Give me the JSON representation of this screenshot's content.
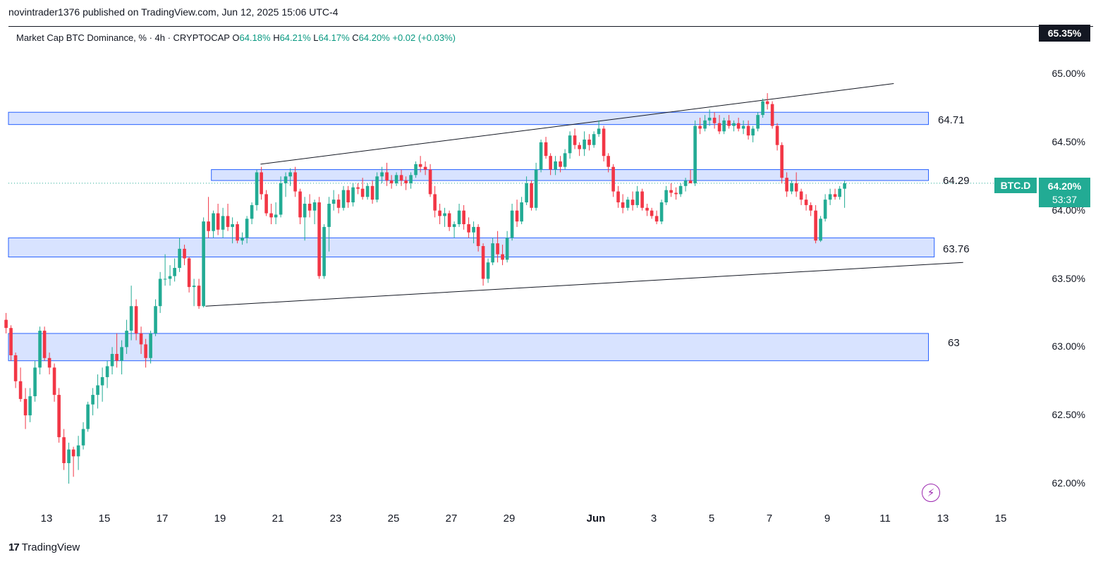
{
  "header": {
    "published": "novintrader1376 published on TradingView.com, Jun 12, 2025 15:06 UTC-4"
  },
  "legend": {
    "title": "Market Cap BTC Dominance, % · 4h · CRYPTOCAP",
    "o_key": "O",
    "o_val": "64.18%",
    "h_key": "H",
    "h_val": "64.21%",
    "l_key": "L",
    "l_val": "64.17%",
    "c_key": "C",
    "c_val": "64.20%",
    "change": "+0.02 (+0.03%)"
  },
  "price_axis": {
    "top_badge": "65.35%",
    "symbol_badge": "BTC.D",
    "last_price": "64.20%",
    "countdown": "53:37"
  },
  "zones": {
    "z1": "64.71",
    "z2": "64.29",
    "z3": "63.76",
    "z4": "63"
  },
  "footer": {
    "brand": "TradingView"
  },
  "colors": {
    "up": "#22ab94",
    "down": "#f23645",
    "zone_fill": "#d1deff",
    "zone_border": "#2962ff",
    "line": "#131722"
  },
  "chart_data": {
    "type": "candlestick",
    "title": "Market Cap BTC Dominance, % · 4h · CRYPTOCAP",
    "ylim": [
      61.85,
      65.45
    ],
    "y_ticks": [
      "62.00%",
      "62.50%",
      "63.00%",
      "63.50%",
      "64.00%",
      "64.50%",
      "65.00%"
    ],
    "y_tick_values": [
      62.0,
      62.5,
      63.0,
      63.5,
      64.0,
      64.5,
      65.0
    ],
    "x_ticks": [
      "13",
      "15",
      "17",
      "19",
      "21",
      "23",
      "25",
      "27",
      "29",
      "Jun",
      "3",
      "5",
      "7",
      "9",
      "11",
      "13",
      "15"
    ],
    "x_tick_days": [
      13,
      15,
      17,
      19,
      21,
      23,
      25,
      27,
      29,
      32,
      34,
      36,
      38,
      40,
      42,
      44,
      46
    ],
    "x_range_days": [
      11.6,
      48.3
    ],
    "zones": [
      {
        "label": "64.71",
        "low": 64.63,
        "high": 64.72,
        "start_day": 11.6,
        "end_day": 43.5
      },
      {
        "label": "64.29",
        "low": 64.22,
        "high": 64.3,
        "start_day": 18.7,
        "end_day": 43.5
      },
      {
        "label": "63.76",
        "low": 63.66,
        "high": 63.8,
        "start_day": 11.6,
        "end_day": 43.7
      },
      {
        "label": "63",
        "low": 62.9,
        "high": 63.1,
        "start_day": 11.6,
        "end_day": 43.5
      }
    ],
    "trendlines": [
      {
        "from": [
          20.4,
          64.34
        ],
        "to": [
          42.3,
          64.93
        ]
      },
      {
        "from": [
          18.5,
          63.3
        ],
        "to": [
          44.7,
          63.62
        ]
      }
    ],
    "last_price": 64.2,
    "candles": [
      [
        11.6,
        63.2,
        63.25,
        63.1,
        63.14
      ],
      [
        11.77,
        63.14,
        63.16,
        62.9,
        62.94
      ],
      [
        11.93,
        62.94,
        62.96,
        62.7,
        62.75
      ],
      [
        12.1,
        62.75,
        62.85,
        62.6,
        62.62
      ],
      [
        12.27,
        62.62,
        62.7,
        62.4,
        62.5
      ],
      [
        12.43,
        62.5,
        62.7,
        62.45,
        62.64
      ],
      [
        12.6,
        62.64,
        62.9,
        62.6,
        62.85
      ],
      [
        12.77,
        62.85,
        63.15,
        62.8,
        63.12
      ],
      [
        12.93,
        63.12,
        63.15,
        62.9,
        62.92
      ],
      [
        13.1,
        62.92,
        62.96,
        62.8,
        62.85
      ],
      [
        13.27,
        62.85,
        62.88,
        62.6,
        62.65
      ],
      [
        13.43,
        62.65,
        62.7,
        62.3,
        62.34
      ],
      [
        13.6,
        62.34,
        62.4,
        62.1,
        62.15
      ],
      [
        13.77,
        62.15,
        62.3,
        62.0,
        62.25
      ],
      [
        13.93,
        62.25,
        62.27,
        62.05,
        62.2
      ],
      [
        14.1,
        62.2,
        62.35,
        62.1,
        62.28
      ],
      [
        14.27,
        62.28,
        62.45,
        62.25,
        62.4
      ],
      [
        14.43,
        62.4,
        62.6,
        62.38,
        62.58
      ],
      [
        14.6,
        62.58,
        62.7,
        62.5,
        62.65
      ],
      [
        14.77,
        62.65,
        62.8,
        62.55,
        62.72
      ],
      [
        14.93,
        62.72,
        62.85,
        62.6,
        62.78
      ],
      [
        15.1,
        62.78,
        62.9,
        62.7,
        62.86
      ],
      [
        15.27,
        62.86,
        63.0,
        62.8,
        62.95
      ],
      [
        15.43,
        62.95,
        63.1,
        62.85,
        62.9
      ],
      [
        15.6,
        62.9,
        63.05,
        62.8,
        63.0
      ],
      [
        15.77,
        63.0,
        63.2,
        62.95,
        63.12
      ],
      [
        15.93,
        63.12,
        63.45,
        63.05,
        63.3
      ],
      [
        16.1,
        63.3,
        63.35,
        63.05,
        63.1
      ],
      [
        16.27,
        63.1,
        63.15,
        62.95,
        63.02
      ],
      [
        16.43,
        63.02,
        63.06,
        62.85,
        62.92
      ],
      [
        16.6,
        62.92,
        63.12,
        62.88,
        63.1
      ],
      [
        16.77,
        63.1,
        63.35,
        63.08,
        63.3
      ],
      [
        16.93,
        63.3,
        63.55,
        63.25,
        63.5
      ],
      [
        17.1,
        63.5,
        63.68,
        63.45,
        63.5
      ],
      [
        17.27,
        63.5,
        63.6,
        63.45,
        63.52
      ],
      [
        17.43,
        63.52,
        63.65,
        63.48,
        63.58
      ],
      [
        17.6,
        63.58,
        63.8,
        63.55,
        63.72
      ],
      [
        17.77,
        63.72,
        63.75,
        63.6,
        63.65
      ],
      [
        17.93,
        63.65,
        63.66,
        63.4,
        63.44
      ],
      [
        18.1,
        63.44,
        63.5,
        63.3,
        63.45
      ],
      [
        18.27,
        63.45,
        63.5,
        63.28,
        63.3
      ],
      [
        18.43,
        63.3,
        63.95,
        63.29,
        63.92
      ],
      [
        18.6,
        63.92,
        64.1,
        63.8,
        63.85
      ],
      [
        18.77,
        63.85,
        64.0,
        63.8,
        63.98
      ],
      [
        18.93,
        63.98,
        64.05,
        63.82,
        63.86
      ],
      [
        19.1,
        63.86,
        64.02,
        63.8,
        63.96
      ],
      [
        19.27,
        63.96,
        64.05,
        63.85,
        63.88
      ],
      [
        19.43,
        63.88,
        63.95,
        63.76,
        63.9
      ],
      [
        19.6,
        63.9,
        63.92,
        63.76,
        63.78
      ],
      [
        19.77,
        63.78,
        63.84,
        63.75,
        63.8
      ],
      [
        19.93,
        63.8,
        63.96,
        63.76,
        63.94
      ],
      [
        20.1,
        63.94,
        64.06,
        63.9,
        64.04
      ],
      [
        20.27,
        64.04,
        64.3,
        64.0,
        64.28
      ],
      [
        20.43,
        64.28,
        64.32,
        64.08,
        64.12
      ],
      [
        20.6,
        64.12,
        64.15,
        63.96,
        63.98
      ],
      [
        20.77,
        63.98,
        64.05,
        63.9,
        63.95
      ],
      [
        20.93,
        63.95,
        64.06,
        63.9,
        63.97
      ],
      [
        21.1,
        63.97,
        64.25,
        63.95,
        64.2
      ],
      [
        21.27,
        64.2,
        64.28,
        64.1,
        64.25
      ],
      [
        21.43,
        64.25,
        64.31,
        64.18,
        64.28
      ],
      [
        21.6,
        64.28,
        64.32,
        64.1,
        64.14
      ],
      [
        21.77,
        64.14,
        64.16,
        63.9,
        63.95
      ],
      [
        21.93,
        63.95,
        64.1,
        63.78,
        64.05
      ],
      [
        22.1,
        64.05,
        64.12,
        63.95,
        64.0
      ],
      [
        22.27,
        64.0,
        64.08,
        63.9,
        64.06
      ],
      [
        22.43,
        64.06,
        64.1,
        63.5,
        63.52
      ],
      [
        22.6,
        63.52,
        63.9,
        63.5,
        63.88
      ],
      [
        22.77,
        63.88,
        64.1,
        63.7,
        64.05
      ],
      [
        22.93,
        64.05,
        64.15,
        64.0,
        64.08
      ],
      [
        23.1,
        64.08,
        64.12,
        63.98,
        64.02
      ],
      [
        23.27,
        64.02,
        64.18,
        64.0,
        64.15
      ],
      [
        23.43,
        64.15,
        64.18,
        64.02,
        64.06
      ],
      [
        23.6,
        64.06,
        64.2,
        64.03,
        64.17
      ],
      [
        23.77,
        64.17,
        64.2,
        64.12,
        64.16
      ],
      [
        23.93,
        64.16,
        64.24,
        64.08,
        64.1
      ],
      [
        24.1,
        64.1,
        64.2,
        64.08,
        64.18
      ],
      [
        24.27,
        64.18,
        64.22,
        64.05,
        64.08
      ],
      [
        24.43,
        64.08,
        64.28,
        64.06,
        64.25
      ],
      [
        24.6,
        64.25,
        64.32,
        64.2,
        64.28
      ],
      [
        24.77,
        64.28,
        64.35,
        64.18,
        64.22
      ],
      [
        24.93,
        64.22,
        64.26,
        64.16,
        64.2
      ],
      [
        25.1,
        64.2,
        64.28,
        64.18,
        64.26
      ],
      [
        25.27,
        64.26,
        64.3,
        64.18,
        64.22
      ],
      [
        25.43,
        64.22,
        64.25,
        64.15,
        64.2
      ],
      [
        25.6,
        64.2,
        64.28,
        64.16,
        64.26
      ],
      [
        25.77,
        64.26,
        64.36,
        64.24,
        64.34
      ],
      [
        25.93,
        64.34,
        64.4,
        64.28,
        64.32
      ],
      [
        26.1,
        64.32,
        64.36,
        64.26,
        64.3
      ],
      [
        26.27,
        64.3,
        64.34,
        64.1,
        64.12
      ],
      [
        26.43,
        64.12,
        64.18,
        63.95,
        64.0
      ],
      [
        26.6,
        64.0,
        64.05,
        63.9,
        63.96
      ],
      [
        26.77,
        63.96,
        64.02,
        63.88,
        63.98
      ],
      [
        26.93,
        63.98,
        64.0,
        63.85,
        63.88
      ],
      [
        27.1,
        63.88,
        63.92,
        63.8,
        63.9
      ],
      [
        27.27,
        63.9,
        64.05,
        63.88,
        64.0
      ],
      [
        27.43,
        64.0,
        64.04,
        63.86,
        63.9
      ],
      [
        27.6,
        63.9,
        63.95,
        63.8,
        63.84
      ],
      [
        27.77,
        63.84,
        63.92,
        63.76,
        63.88
      ],
      [
        27.93,
        63.88,
        63.9,
        63.7,
        63.74
      ],
      [
        28.1,
        63.74,
        63.76,
        63.45,
        63.5
      ],
      [
        28.27,
        63.5,
        63.65,
        63.47,
        63.62
      ],
      [
        28.43,
        63.62,
        63.8,
        63.6,
        63.76
      ],
      [
        28.6,
        63.76,
        63.85,
        63.62,
        63.68
      ],
      [
        28.77,
        63.68,
        63.75,
        63.6,
        63.64
      ],
      [
        28.93,
        63.64,
        63.85,
        63.62,
        63.8
      ],
      [
        29.1,
        63.8,
        64.05,
        63.78,
        64.0
      ],
      [
        29.27,
        64.0,
        64.08,
        63.88,
        63.92
      ],
      [
        29.43,
        63.92,
        64.1,
        63.9,
        64.06
      ],
      [
        29.6,
        64.06,
        64.25,
        64.04,
        64.2
      ],
      [
        29.77,
        64.2,
        64.22,
        64.0,
        64.02
      ],
      [
        29.93,
        64.02,
        64.35,
        64.0,
        64.3
      ],
      [
        30.1,
        64.3,
        64.52,
        64.28,
        64.5
      ],
      [
        30.27,
        64.5,
        64.54,
        64.38,
        64.4
      ],
      [
        30.43,
        64.4,
        64.42,
        64.26,
        64.3
      ],
      [
        30.6,
        64.3,
        64.4,
        64.26,
        64.36
      ],
      [
        30.77,
        64.36,
        64.4,
        64.28,
        64.32
      ],
      [
        30.93,
        64.32,
        64.45,
        64.3,
        64.42
      ],
      [
        31.1,
        64.42,
        64.58,
        64.38,
        64.55
      ],
      [
        31.27,
        64.55,
        64.6,
        64.45,
        64.48
      ],
      [
        31.43,
        64.48,
        64.5,
        64.4,
        64.45
      ],
      [
        31.6,
        64.45,
        64.58,
        64.4,
        64.52
      ],
      [
        31.77,
        64.52,
        64.56,
        64.44,
        64.48
      ],
      [
        31.93,
        64.48,
        64.58,
        64.46,
        64.56
      ],
      [
        32.1,
        64.56,
        64.66,
        64.54,
        64.6
      ],
      [
        32.27,
        64.6,
        64.62,
        64.36,
        64.4
      ],
      [
        32.43,
        64.4,
        64.42,
        64.28,
        64.32
      ],
      [
        32.6,
        64.32,
        64.34,
        64.1,
        64.14
      ],
      [
        32.77,
        64.14,
        64.18,
        64.02,
        64.06
      ],
      [
        32.93,
        64.06,
        64.12,
        63.98,
        64.02
      ],
      [
        33.1,
        64.02,
        64.1,
        64.0,
        64.08
      ],
      [
        33.27,
        64.08,
        64.14,
        64.0,
        64.04
      ],
      [
        33.43,
        64.04,
        64.18,
        64.02,
        64.14
      ],
      [
        33.6,
        64.14,
        64.16,
        64.0,
        64.02
      ],
      [
        33.77,
        64.02,
        64.05,
        63.96,
        64.0
      ],
      [
        33.93,
        64.0,
        64.02,
        63.94,
        63.96
      ],
      [
        34.1,
        63.96,
        64.0,
        63.9,
        63.92
      ],
      [
        34.27,
        63.92,
        64.08,
        63.9,
        64.06
      ],
      [
        34.43,
        64.06,
        64.18,
        64.04,
        64.15
      ],
      [
        34.6,
        64.15,
        64.2,
        64.1,
        64.13
      ],
      [
        34.77,
        64.13,
        64.17,
        64.08,
        64.12
      ],
      [
        34.93,
        64.12,
        64.2,
        64.1,
        64.18
      ],
      [
        35.1,
        64.18,
        64.24,
        64.14,
        64.22
      ],
      [
        35.27,
        64.22,
        64.3,
        64.2,
        64.2
      ],
      [
        35.43,
        64.2,
        64.66,
        64.18,
        64.62
      ],
      [
        35.6,
        64.62,
        64.68,
        64.56,
        64.6
      ],
      [
        35.77,
        64.6,
        64.7,
        64.58,
        64.66
      ],
      [
        35.93,
        64.66,
        64.74,
        64.62,
        64.68
      ],
      [
        36.1,
        64.68,
        64.72,
        64.6,
        64.64
      ],
      [
        36.27,
        64.64,
        64.7,
        64.56,
        64.58
      ],
      [
        36.43,
        64.58,
        64.68,
        64.56,
        64.66
      ],
      [
        36.6,
        64.66,
        64.7,
        64.6,
        64.62
      ],
      [
        36.77,
        64.62,
        64.66,
        64.58,
        64.64
      ],
      [
        36.93,
        64.64,
        64.68,
        64.58,
        64.6
      ],
      [
        37.1,
        64.6,
        64.66,
        64.56,
        64.62
      ],
      [
        37.27,
        64.62,
        64.66,
        64.52,
        64.55
      ],
      [
        37.43,
        64.55,
        64.62,
        64.5,
        64.6
      ],
      [
        37.6,
        64.6,
        64.72,
        64.58,
        64.7
      ],
      [
        37.77,
        64.7,
        64.82,
        64.68,
        64.8
      ],
      [
        37.93,
        64.8,
        64.86,
        64.74,
        64.78
      ],
      [
        38.1,
        64.78,
        64.8,
        64.6,
        64.62
      ],
      [
        38.27,
        64.62,
        64.64,
        64.44,
        64.48
      ],
      [
        38.43,
        64.48,
        64.5,
        64.2,
        64.24
      ],
      [
        38.6,
        64.24,
        64.28,
        64.1,
        64.14
      ],
      [
        38.77,
        64.14,
        64.22,
        64.12,
        64.2
      ],
      [
        38.93,
        64.2,
        64.28,
        64.1,
        64.14
      ],
      [
        39.1,
        64.14,
        64.16,
        64.04,
        64.08
      ],
      [
        39.27,
        64.08,
        64.12,
        64.0,
        64.04
      ],
      [
        39.43,
        64.04,
        64.06,
        63.96,
        64.0
      ],
      [
        39.6,
        64.0,
        64.04,
        63.76,
        63.78
      ],
      [
        39.77,
        63.78,
        63.96,
        63.77,
        63.94
      ],
      [
        39.93,
        63.94,
        64.12,
        63.92,
        64.08
      ],
      [
        40.1,
        64.08,
        64.16,
        64.04,
        64.12
      ],
      [
        40.27,
        64.12,
        64.16,
        64.08,
        64.1
      ],
      [
        40.43,
        64.1,
        64.18,
        64.08,
        64.16
      ],
      [
        40.6,
        64.16,
        64.22,
        64.02,
        64.2
      ]
    ]
  }
}
